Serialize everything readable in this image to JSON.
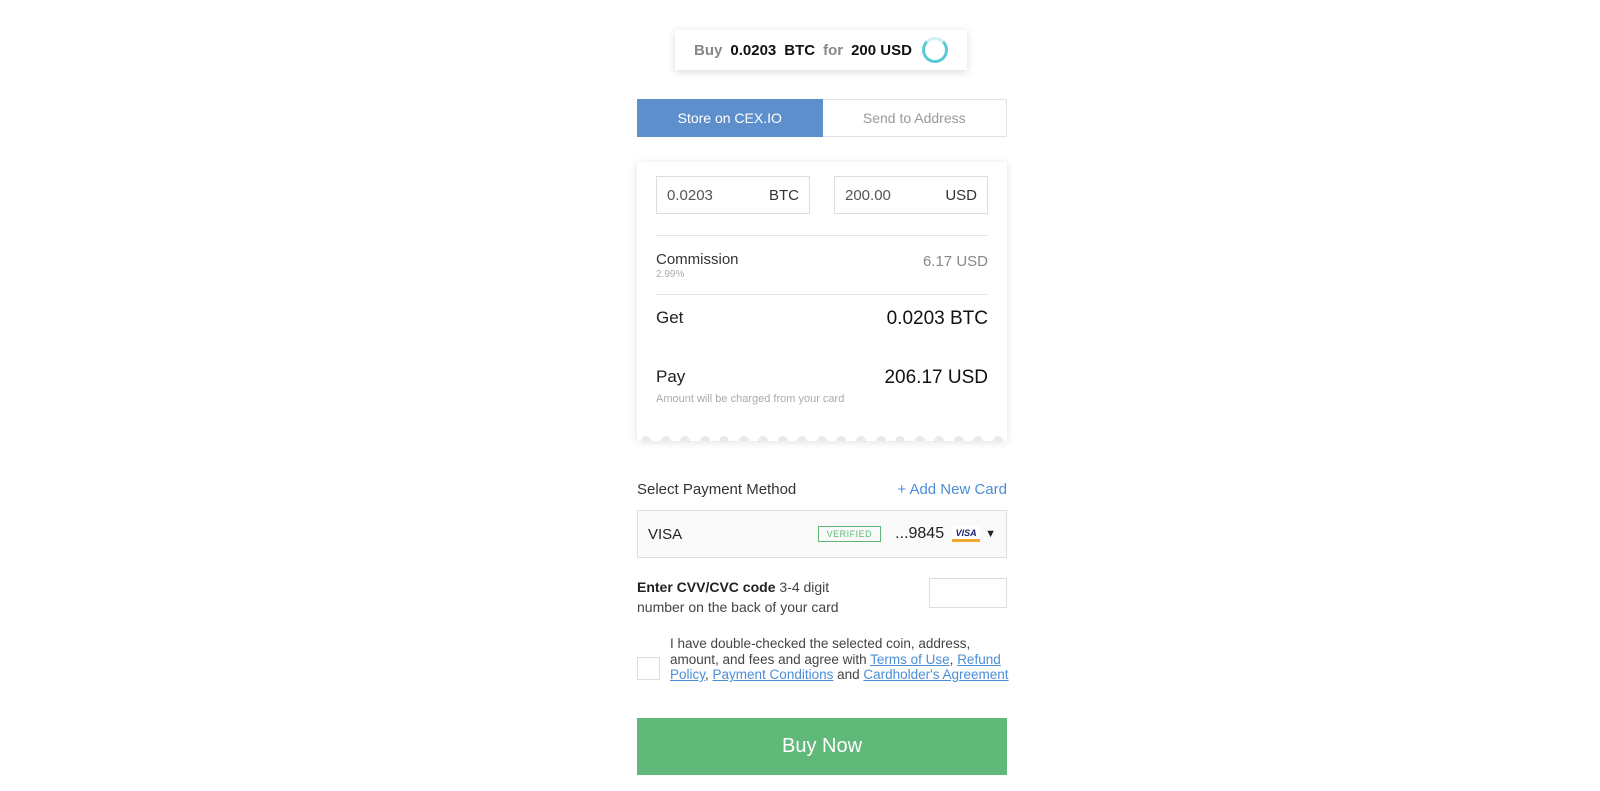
{
  "summary": {
    "buy_label": "Buy",
    "btc_amount": "0.0203",
    "btc_currency": "BTC",
    "for_label": "for",
    "usd_amount": "200 USD",
    "spinner_icon": "loading-spinner-icon",
    "spinner_color": "#5bc8d6"
  },
  "tabs": [
    {
      "label": "Store on CEX.IO",
      "active": true
    },
    {
      "label": "Send to Address",
      "active": false
    }
  ],
  "calculator": {
    "crypto_value": "0.0203",
    "crypto_currency": "BTC",
    "fiat_value": "200.00",
    "fiat_currency": "USD",
    "commission_label": "Commission",
    "commission_percent": "2.99%",
    "commission_value": "6.17 USD",
    "get_label": "Get",
    "get_value": "0.0203 BTC",
    "pay_label": "Pay",
    "pay_value": "206.17 USD",
    "pay_note": "Amount will be charged from your card"
  },
  "payment": {
    "title": "Select Payment Method",
    "add_card": "+ Add New Card",
    "card_brand": "VISA",
    "verified_badge": "VERIFIED",
    "card_last4": "...9845",
    "card_logo_icon": "visa-logo-icon",
    "card_logo_text": "VISA",
    "dropdown_icon": "chevron-down-icon"
  },
  "cvv": {
    "label_bold": "Enter CVV/CVC code",
    "label_rest": " 3-4 digit number on the back of your card",
    "value": ""
  },
  "agreement": {
    "text_start": "I have double-checked the selected coin, address, amount, and fees and agree with ",
    "link_terms": "Terms of Use",
    "sep1": ", ",
    "link_refund": "Refund Policy",
    "sep2": ", ",
    "link_payment": "Payment Conditions",
    "sep3": " and ",
    "link_cardholder": "Cardholder's Agreement"
  },
  "buy_button": "Buy Now",
  "colors": {
    "accent_blue": "#5d8fcc",
    "buy_green": "#60b879",
    "verified_green": "#5fb776",
    "link_blue": "#4a8ed8"
  }
}
